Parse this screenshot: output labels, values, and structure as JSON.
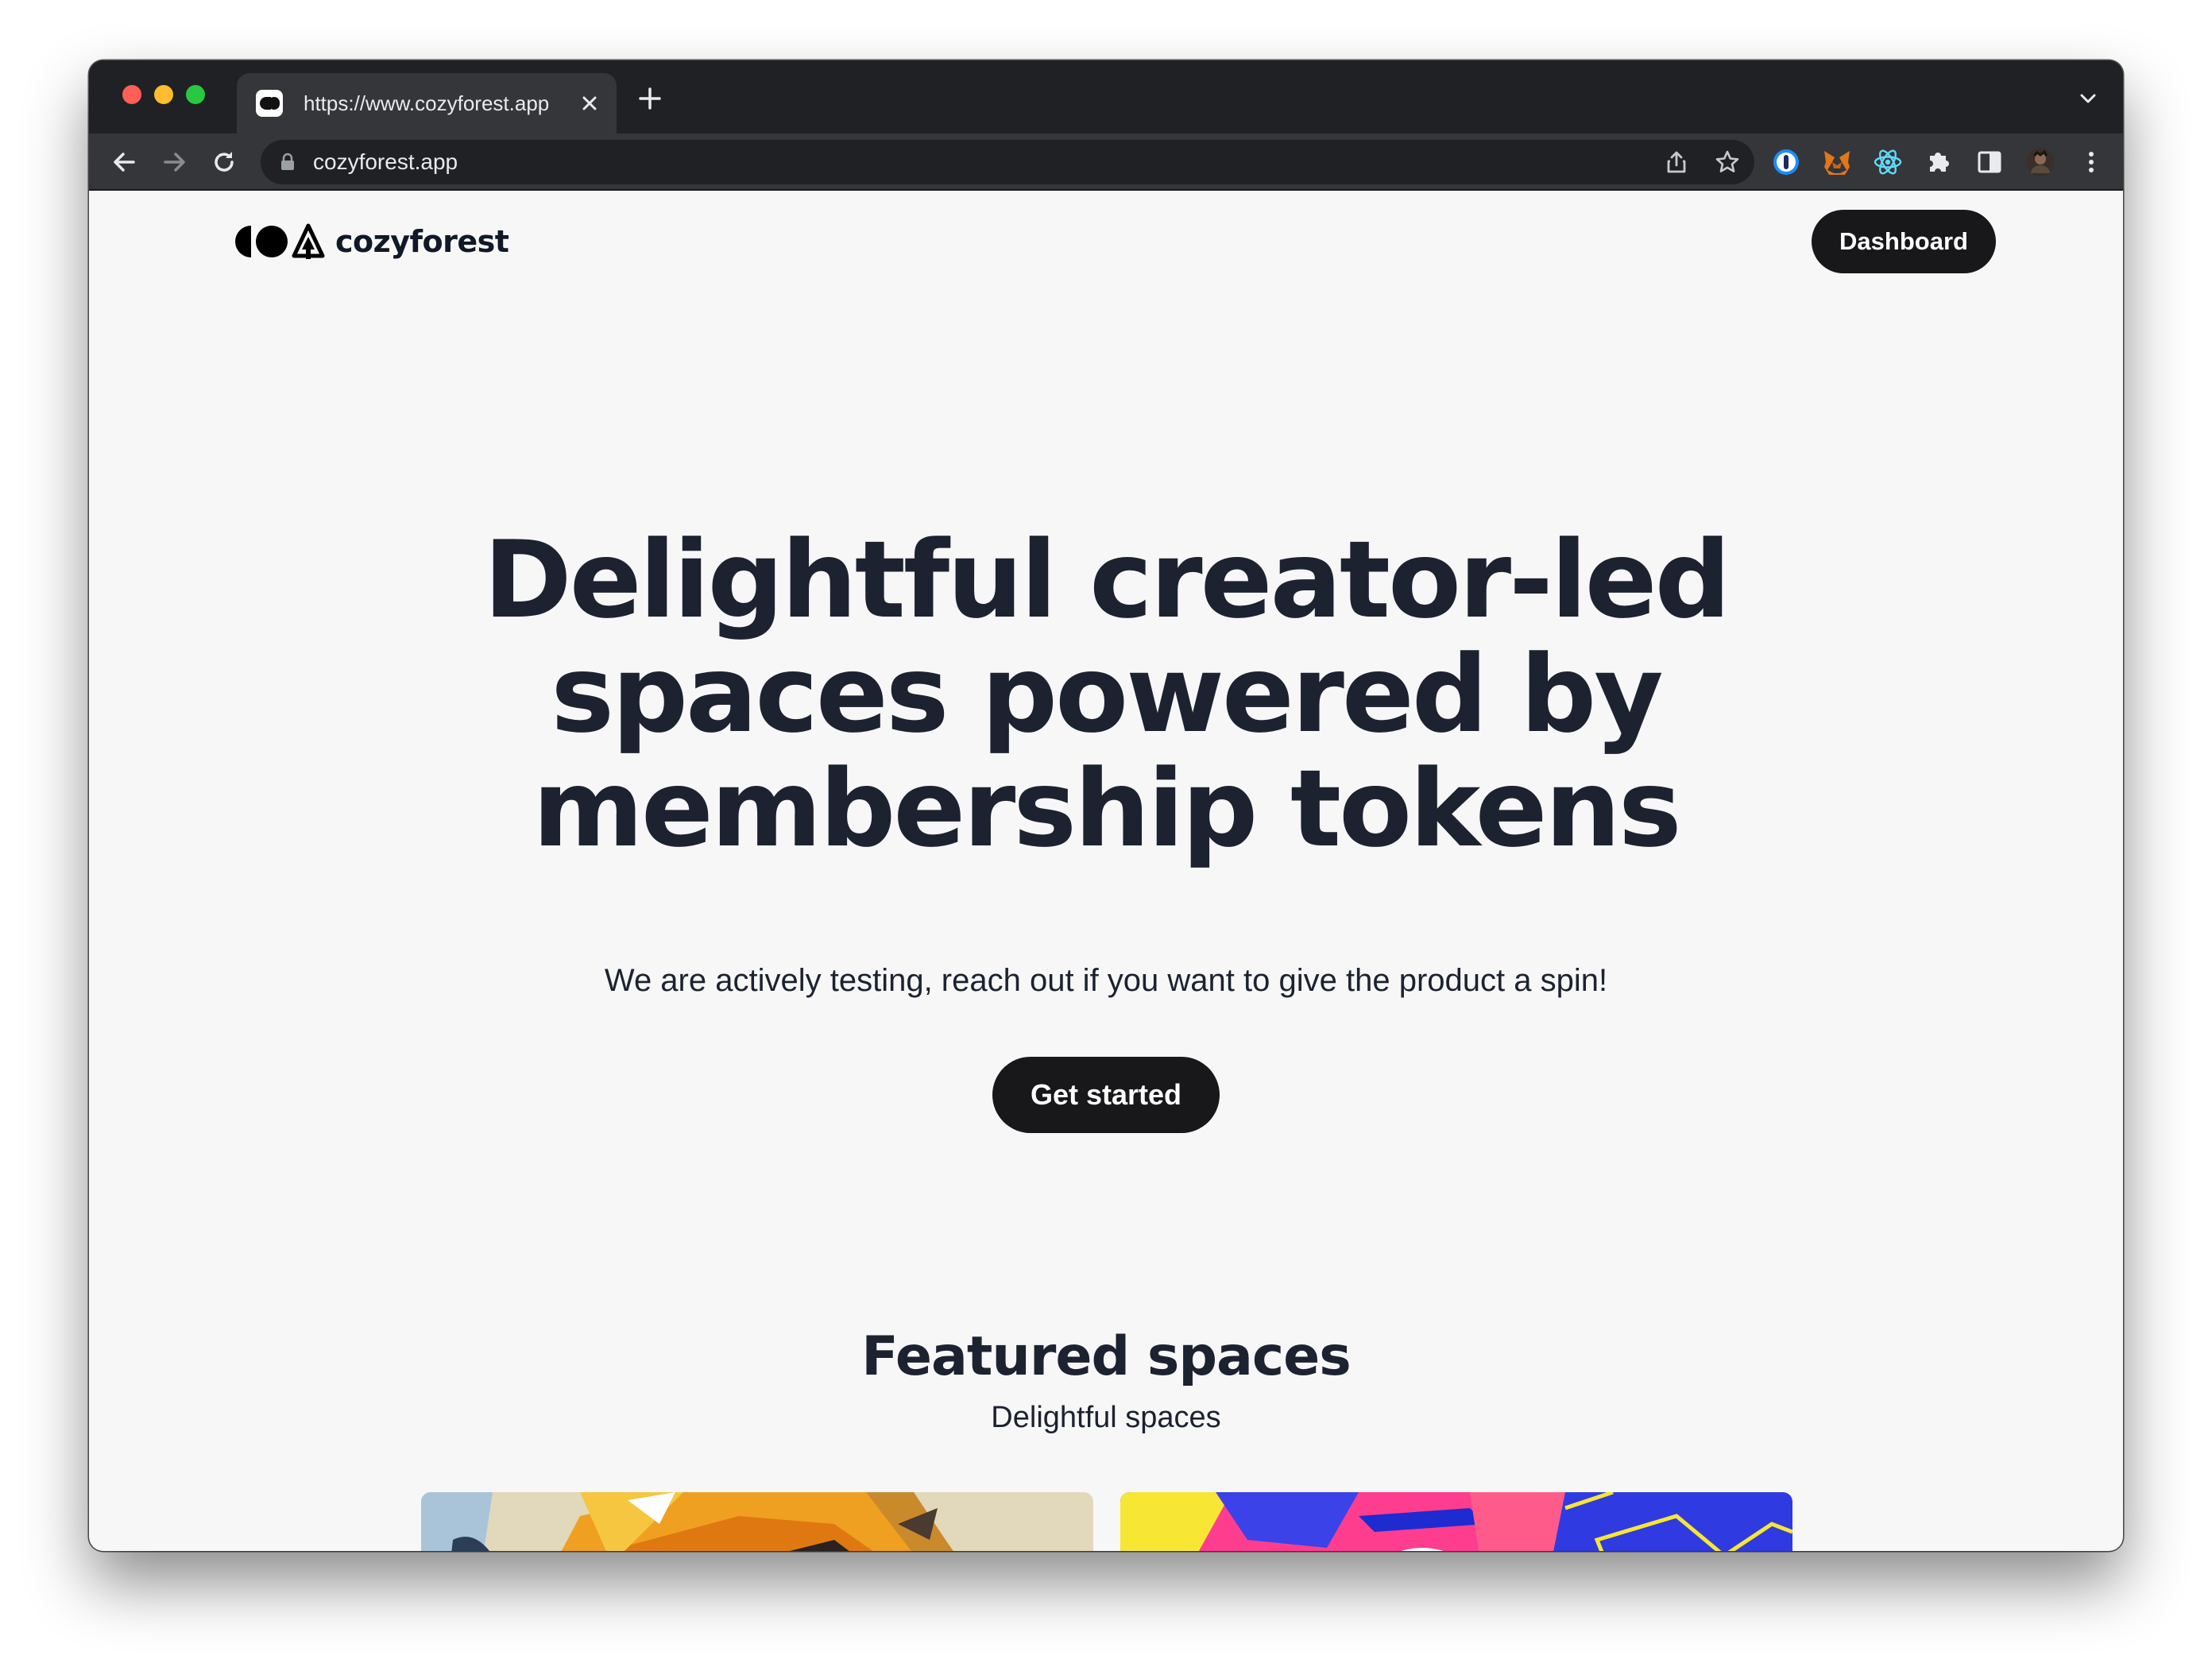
{
  "browser": {
    "tab": {
      "title": "https://www.cozyforest.app",
      "close_label": "×"
    },
    "new_tab_label": "+",
    "address_bar": {
      "url": "cozyforest.app"
    },
    "toolbar_icons": [
      "back-icon",
      "forward-icon",
      "reload-icon",
      "lock-icon",
      "share-icon",
      "bookmark-star-icon",
      "extension-1password-icon",
      "extension-metamask-icon",
      "extension-react-devtools-icon",
      "extensions-puzzle-icon",
      "side-panel-icon",
      "profile-avatar",
      "menu-kebab-icon"
    ]
  },
  "header": {
    "logo_text": "cozyforest",
    "dashboard_label": "Dashboard"
  },
  "hero": {
    "title": "Delightful creator-led spaces powered by membership tokens",
    "subtitle": "We are actively testing, reach out if you want to give the product a spin!",
    "cta_label": "Get started"
  },
  "featured": {
    "title": "Featured spaces",
    "subtitle": "Delightful spaces",
    "cards": [
      {
        "image": "colorful-illustration-orange"
      },
      {
        "image": "colorful-illustration-blue-pink"
      }
    ]
  },
  "colors": {
    "chrome_dark": "#202124",
    "toolbar": "#35363a",
    "page_bg": "#f7f7f7",
    "button_dark": "#18181b",
    "heading_text": "#1c2230"
  }
}
